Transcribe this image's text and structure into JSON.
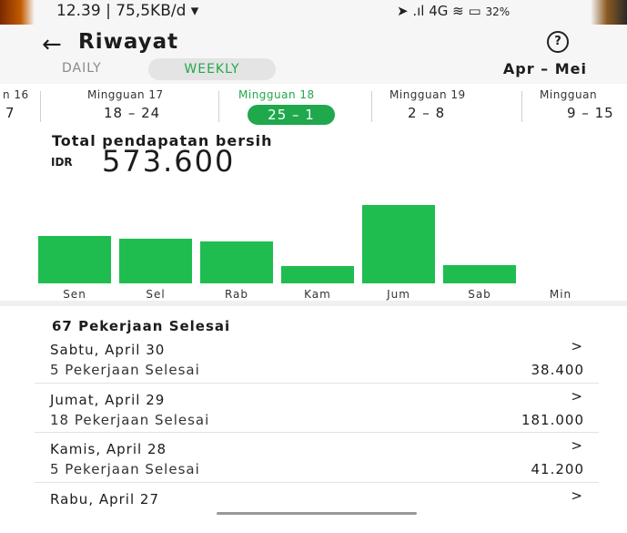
{
  "status_bar": {
    "time_info": "12.39 | 75,5KB/d ▾",
    "icons": "➤ .ıl 4G ≋ ▭",
    "battery": "32%"
  },
  "header": {
    "back_icon": "←",
    "title": "Riwayat",
    "help_icon": "?"
  },
  "tabs": {
    "daily": "DAILY",
    "weekly": "WEEKLY",
    "range": "Apr – Mei"
  },
  "weeks": [
    {
      "label": "n 16",
      "range": "7"
    },
    {
      "label": "Mingguan 17",
      "range": "18 – 24"
    },
    {
      "label": "Mingguan 18",
      "range": "25 – 1",
      "active": true
    },
    {
      "label": "Mingguan 19",
      "range": "2 – 8"
    },
    {
      "label": "Mingguan",
      "range": "9 – 15"
    }
  ],
  "earnings": {
    "label": "Total pendapatan bersih",
    "currency": "IDR",
    "amount": "573.600"
  },
  "chart_data": {
    "type": "bar",
    "categories": [
      "Sen",
      "Sel",
      "Rab",
      "Kam",
      "Jum",
      "Sab",
      "Min"
    ],
    "values": [
      101000,
      95000,
      90000,
      38000,
      168000,
      38400,
      0
    ],
    "colors": {
      "bar": "#1fbd4f"
    }
  },
  "jobs": {
    "header": "67 Pekerjaan Selesai",
    "items": [
      {
        "date": "Sabtu, April 30",
        "count": "5 Pekerjaan Selesai",
        "value": "38.400",
        "chevron": ">"
      },
      {
        "date": "Jumat, April 29",
        "count": "18 Pekerjaan Selesai",
        "value": "181.000",
        "chevron": ">"
      },
      {
        "date": "Kamis, April 28",
        "count": "5 Pekerjaan Selesai",
        "value": "41.200",
        "chevron": ">"
      },
      {
        "date": "Rabu, April 27",
        "count": "",
        "value": "",
        "chevron": ">"
      }
    ]
  },
  "colors": {
    "accent": "#1fa84c",
    "background": "#f6f6f6"
  }
}
